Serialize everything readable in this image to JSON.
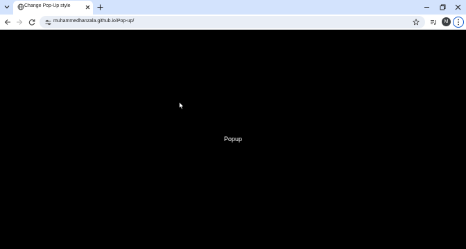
{
  "browser": {
    "tab": {
      "title": "Change Pop-Up style"
    },
    "address_bar": {
      "url": "muhammedhanzala.github.io/Pop-up/"
    },
    "profile_initial": "M"
  },
  "page": {
    "popup_text": "Popup",
    "background_color": "#000000"
  },
  "icons": [
    "tab-search-icon",
    "globe-icon",
    "close-icon",
    "plus-icon",
    "minimize-icon",
    "restore-icon",
    "window-close-icon",
    "back-arrow-icon",
    "forward-arrow-icon",
    "reload-icon",
    "site-info-icon",
    "star-icon",
    "media-control-icon",
    "kebab-menu-icon",
    "mouse-pointer-icon"
  ]
}
